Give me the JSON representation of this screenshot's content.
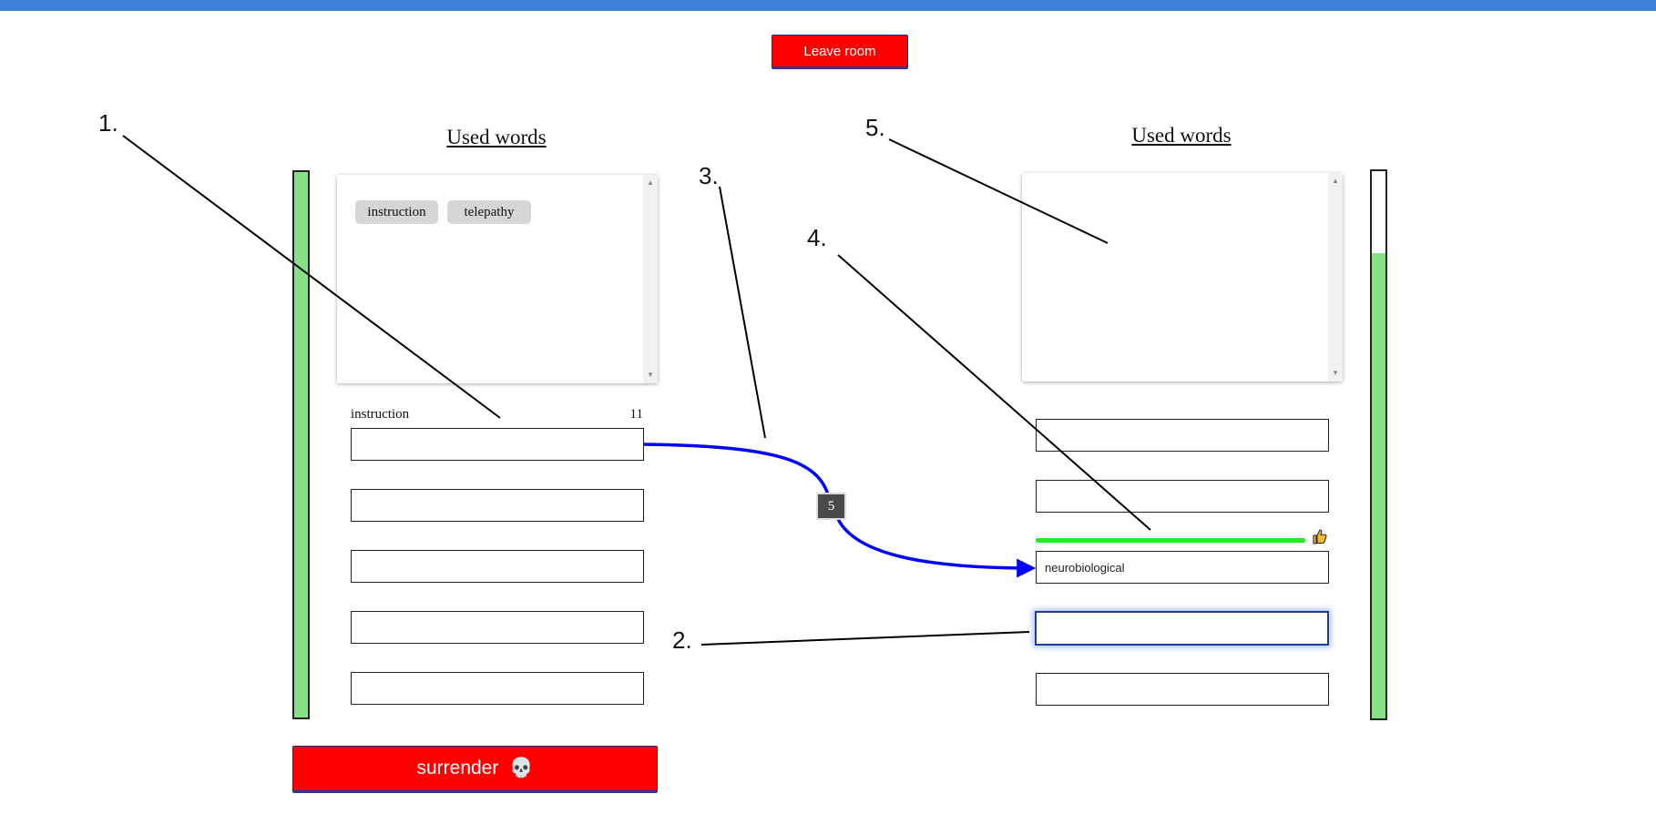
{
  "header": {
    "leave_label": "Leave room"
  },
  "left_panel": {
    "title": "Used words",
    "chips": [
      "instruction",
      "telepathy"
    ],
    "current_word": "instruction",
    "current_count": "11",
    "fields": [
      "",
      "",
      "",
      "",
      ""
    ],
    "health_level": 1.0
  },
  "right_panel": {
    "title": "Used words",
    "chips": [],
    "fields": [
      "",
      "",
      "neurobiological",
      "",
      ""
    ],
    "health_level": 0.85,
    "match_progress": 1.0,
    "thumb_icon": "thumbs-up-icon"
  },
  "link_badge": "5",
  "annotations": [
    "1.",
    "2.",
    "3.",
    "4.",
    "5."
  ],
  "surrender": {
    "label": "surrender",
    "icon": "skull-icon",
    "glyph": "💀"
  },
  "colors": {
    "topbar": "#3f7fd7",
    "danger": "#ff0000",
    "health": "#86e086",
    "arrow": "#0000ff",
    "match": "#22ee22"
  }
}
